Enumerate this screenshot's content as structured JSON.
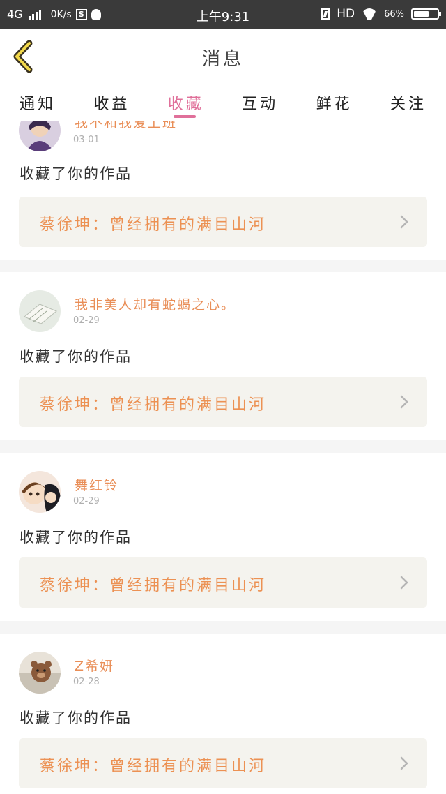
{
  "status_bar": {
    "network": "4G",
    "speed": "0K/s",
    "s_icon": "S",
    "time": "上午9:31",
    "hd": "HD",
    "battery": "66%",
    "battery_level": 0.66
  },
  "header": {
    "title": "消息"
  },
  "tabs": [
    {
      "label": "通知",
      "active": false
    },
    {
      "label": "收益",
      "active": false
    },
    {
      "label": "收藏",
      "active": true
    },
    {
      "label": "互动",
      "active": false
    },
    {
      "label": "鲜花",
      "active": false
    },
    {
      "label": "关注",
      "active": false
    }
  ],
  "items": [
    {
      "user": "我不和我爱上班",
      "date": "03-01",
      "message": "收藏了你的作品",
      "work": "蔡徐坤：曾经拥有的满目山河",
      "avatar": "avatar-purple-character-icon"
    },
    {
      "user": "我非美人却有蛇蝎之心。",
      "date": "02-29",
      "message": "收藏了你的作品",
      "work": "蔡徐坤：曾经拥有的满目山河",
      "avatar": "avatar-sketch-icon"
    },
    {
      "user": "舞红铃",
      "date": "02-29",
      "message": "收藏了你的作品",
      "work": "蔡徐坤：曾经拥有的满目山河",
      "avatar": "avatar-anime-girls-icon"
    },
    {
      "user": "Z希妍",
      "date": "02-28",
      "message": "收藏了你的作品",
      "work": "蔡徐坤：曾经拥有的满目山河",
      "avatar": "avatar-bear-icon"
    }
  ],
  "colors": {
    "accent_pink": "#e0709a",
    "username_orange": "#e98e57",
    "work_text_orange": "#ec9153",
    "work_bg": "#f4f3ee",
    "status_bar_bg": "#3a3a3a"
  }
}
